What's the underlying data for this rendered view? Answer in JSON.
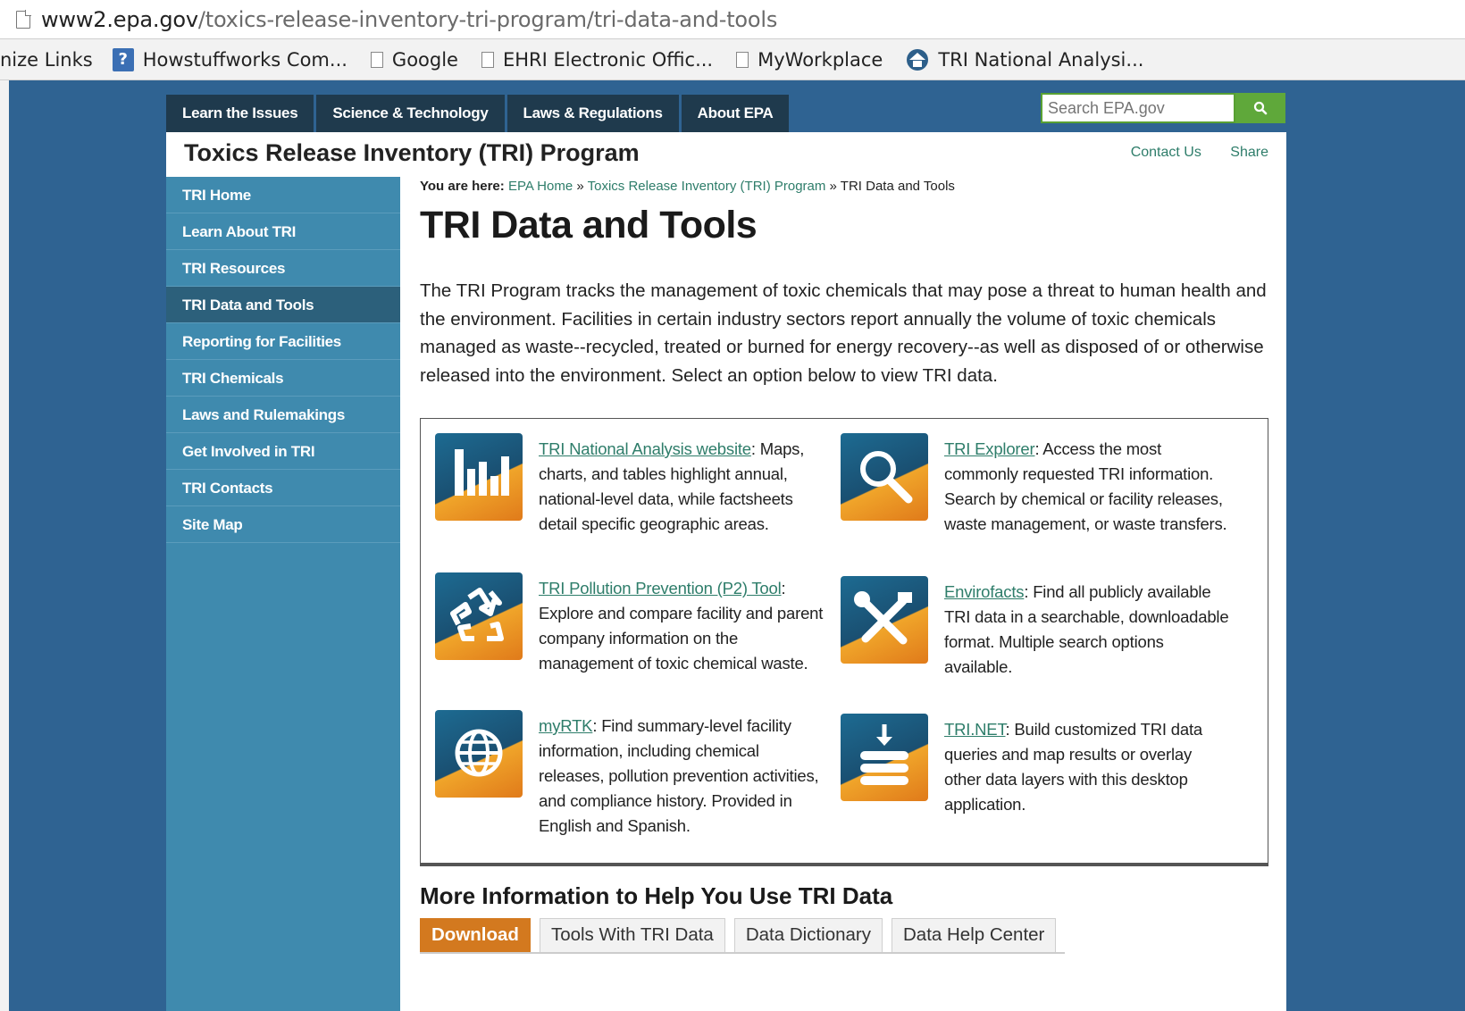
{
  "browser": {
    "url_host": "www2.epa.gov",
    "url_path": "/toxics-release-inventory-tri-program/tri-data-and-tools",
    "bookmarks": [
      {
        "label": "nize Links",
        "icon": "none"
      },
      {
        "label": "Howstuffworks Com...",
        "icon": "howstuffworks-icon"
      },
      {
        "label": "Google",
        "icon": "page-icon"
      },
      {
        "label": "EHRI Electronic Offic...",
        "icon": "page-icon"
      },
      {
        "label": "MyWorkplace",
        "icon": "page-icon"
      },
      {
        "label": "TRI National Analysi...",
        "icon": "tri-logo-icon"
      }
    ]
  },
  "topnav": {
    "tabs": [
      "Learn the Issues",
      "Science & Technology",
      "Laws & Regulations",
      "About EPA"
    ],
    "search_placeholder": "Search EPA.gov"
  },
  "header": {
    "title": "Toxics Release Inventory (TRI) Program",
    "contact": "Contact Us",
    "share": "Share"
  },
  "sidebar": {
    "items": [
      {
        "label": "TRI Home"
      },
      {
        "label": "Learn About TRI"
      },
      {
        "label": "TRI Resources"
      },
      {
        "label": "TRI Data and Tools"
      },
      {
        "label": "Reporting for Facilities"
      },
      {
        "label": "TRI Chemicals"
      },
      {
        "label": "Laws and Rulemakings"
      },
      {
        "label": "Get Involved in TRI"
      },
      {
        "label": "TRI Contacts"
      },
      {
        "label": "Site Map"
      }
    ],
    "active": "TRI Data and Tools"
  },
  "breadcrumb": {
    "prefix": "You are here:",
    "items": [
      "EPA Home",
      "Toxics Release Inventory (TRI) Program",
      "TRI Data and Tools"
    ],
    "sep": "»"
  },
  "page": {
    "title": "TRI Data and Tools",
    "intro": "The TRI Program tracks the management of toxic chemicals that may pose a threat to human health and the environment. Facilities in certain industry sectors report annually the volume of toxic chemicals managed as waste--recycled, treated or burned for energy recovery--as well as disposed of or otherwise released into the environment. Select an option below to view TRI data."
  },
  "tools": [
    {
      "link": "TRI National Analysis website",
      "desc": ": Maps, charts, and tables highlight annual, national-level data, while factsheets detail specific geographic areas.",
      "icon": "bar-chart-icon"
    },
    {
      "link": "TRI Explorer",
      "desc": ": Access the most commonly requested TRI information. Search by chemical or facility releases, waste management, or waste transfers.",
      "icon": "magnifier-icon"
    },
    {
      "link": "TRI Pollution Prevention (P2) Tool",
      "desc": ": Explore and compare facility and parent company information on the management of toxic chemical waste.",
      "icon": "recycle-icon"
    },
    {
      "link": "Envirofacts",
      "desc": ": Find all publicly available TRI data in a searchable, downloadable format. Multiple search options available.",
      "icon": "tools-icon"
    },
    {
      "link": "myRTK",
      "desc": ": Find summary-level facility information, including chemical releases, pollution prevention activities, and compliance history. Provided in English and Spanish.",
      "icon": "globe-icon"
    },
    {
      "link": "TRI.NET",
      "desc": ": Build customized TRI data queries and map results or overlay other data layers with this desktop application.",
      "icon": "database-download-icon"
    }
  ],
  "more": {
    "title": "More Information to Help You Use TRI Data",
    "tabs": [
      "Download",
      "Tools With TRI Data",
      "Data Dictionary",
      "Data Help Center"
    ],
    "active_tab": "Download"
  },
  "colors": {
    "page_bg": "#2f6392",
    "topnav_bg": "#1f3a4d",
    "sidebar_bg": "#3f8aae",
    "sidebar_active": "#2c607b",
    "link": "#2e7d6a",
    "accent_orange": "#d3791f",
    "search_green": "#5fa83a"
  }
}
